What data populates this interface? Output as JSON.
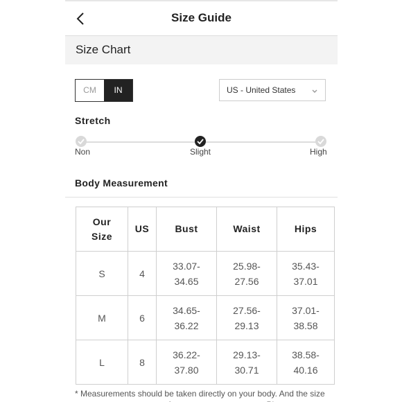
{
  "header": {
    "title": "Size Guide"
  },
  "section": {
    "title": "Size Chart"
  },
  "units": {
    "cm_label": "CM",
    "in_label": "IN",
    "selected": "IN"
  },
  "country": {
    "selected": "US - United States"
  },
  "stretch": {
    "title": "Stretch",
    "levels": [
      "Non",
      "Slight",
      "High"
    ],
    "selected": "Slight"
  },
  "body_measurement": {
    "title": "Body Measurement",
    "headers": [
      "Our Size",
      "US",
      "Bust",
      "Waist",
      "Hips"
    ],
    "rows": [
      [
        "S",
        "4",
        "33.07-34.65",
        "25.98-27.56",
        "35.43-37.01"
      ],
      [
        "M",
        "6",
        "34.65-36.22",
        "27.56-29.13",
        "37.01-38.58"
      ],
      [
        "L",
        "8",
        "36.22-37.80",
        "29.13-30.71",
        "38.58-40.16"
      ]
    ]
  },
  "note": "* Measurements should be taken directly on your body. And the size measurements may vary from category to category. Please pay"
}
